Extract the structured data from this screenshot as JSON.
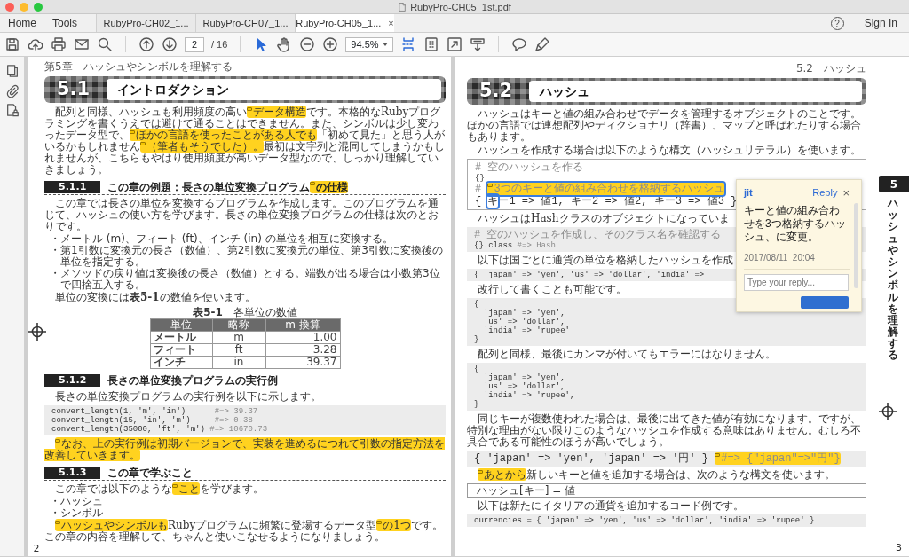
{
  "window": {
    "title": "RubyPro-CH05_1st.pdf"
  },
  "nav": {
    "home": "Home",
    "tools": "Tools",
    "help_glyph": "?",
    "sign_in": "Sign In"
  },
  "tabs": [
    {
      "label": "RubyPro-CH02_1...",
      "selected": false
    },
    {
      "label": "RubyPro-CH07_1...",
      "selected": false
    },
    {
      "label": "RubyPro-CH05_1...",
      "selected": true,
      "close_glyph": "×"
    }
  ],
  "toolbar": {
    "page_number": "2",
    "page_count": "/ 16",
    "zoom": "94.5%",
    "tool_modes": [
      {
        "selected": true
      },
      {
        "selected": false
      }
    ],
    "view_modes": [
      {
        "selected": true
      },
      {
        "selected": false
      },
      {
        "selected": false
      },
      {
        "selected": false
      }
    ]
  },
  "left_page": {
    "running_head": "第5章　ハッシュやシンボルを理解する",
    "page_number": "2",
    "blocks": [
      {
        "kind": "title",
        "number": "5.1",
        "text": "イントロダクション"
      },
      {
        "kind": "paragraph",
        "segments": [
          "配列と同様、ハッシュも利用頻度の高い",
          {
            "text": "データ構造",
            "highlight": true,
            "note": true
          },
          "です。本格的なRubyプログラミングを書くうえでは避けて通ることはできません。また、シンボルは少し変わったデータ型で、",
          {
            "text": "ほかの言語を使ったことがある人でも",
            "highlight": true,
            "note": true
          },
          "「初めて見た」と思う人がいるかもしれません",
          {
            "text": "（筆者もそうでした）。",
            "highlight": true,
            "note": true
          },
          "最初は文字列と混同してしまうかもしれませんが、こちらもやはり使用頻度が高いデータ型なので、しっかり理解していきましょう。"
        ]
      },
      {
        "kind": "subheading",
        "number": "5.1.1",
        "segments": [
          "この章の例題：長さの単位変換プログラム",
          {
            "text": "の仕様",
            "highlight": true,
            "note": true
          }
        ]
      },
      {
        "kind": "paragraph",
        "segments": [
          "この章では長さの単位を変換するプログラムを作成します。このプログラムを通じて、ハッシュの使い方を学びます。長さの単位変換プログラムの仕様は次のとおりです。"
        ]
      },
      {
        "kind": "bullet",
        "text": "・メートル (m)、フィート (ft)、インチ (in) の単位を相互に変換する。"
      },
      {
        "kind": "bullet",
        "text": "・第1引数に変換元の長さ（数値）、第2引数に変換元の単位、第3引数に変換後の単位を指定する。"
      },
      {
        "kind": "bullet",
        "text": "・メソッドの戻り値は変換後の長さ（数値）とする。端数が出る場合は小数第3位で四捨五入する。"
      },
      {
        "kind": "paragraph",
        "segments": [
          "単位の変換には**表5-1**の数値を使います。"
        ]
      },
      {
        "kind": "caption",
        "text": "**表5-1**　各単位の数値"
      },
      {
        "kind": "table",
        "columns": [
          "単位",
          "略称",
          "m 換算"
        ],
        "rows": [
          [
            "メートル",
            "m",
            "1.00"
          ],
          [
            "フィート",
            "ft",
            "3.28"
          ],
          [
            "インチ",
            "in",
            "39.37"
          ]
        ]
      },
      {
        "kind": "subheading",
        "number": "5.1.2",
        "segments": [
          "長さの単位変換プログラムの実行例"
        ]
      },
      {
        "kind": "paragraph",
        "segments": [
          "長さの単位変換プログラムの実行例を以下に示します。"
        ]
      },
      {
        "kind": "code",
        "lines": [
          [
            "convert_length(1, 'm', 'in')      ",
            {
              "text": "#=> 39.37",
              "kind": "comment"
            }
          ],
          [
            "convert_length(15, 'in', 'm')     ",
            {
              "text": "#=> 0.38",
              "kind": "comment"
            }
          ],
          [
            "convert_length(35000, 'ft', 'm') ",
            {
              "text": "#=> 10670.73",
              "kind": "comment"
            }
          ]
        ]
      },
      {
        "kind": "paragraph",
        "segments": [
          {
            "text": "なお、上の実行例は初期バージョンで、実装を進めるにつれて引数の指定方法を改善していきます。",
            "highlight": true,
            "note": true
          }
        ]
      },
      {
        "kind": "subheading",
        "number": "5.1.3",
        "segments": [
          "この章で学ぶこと"
        ]
      },
      {
        "kind": "paragraph",
        "segments": [
          "この章では以下のような",
          {
            "text": "こと",
            "highlight": true,
            "note": true
          },
          "を学びます。"
        ]
      },
      {
        "kind": "bullet",
        "text": "・ハッシュ"
      },
      {
        "kind": "bullet",
        "text": "・シンボル"
      },
      {
        "kind": "paragraph",
        "segments": [
          {
            "text": "ハッシュやシンボルも",
            "highlight": true,
            "note": true
          },
          "Rubyプログラムに頻繁に登場するデータ型",
          {
            "text": "の1つ",
            "highlight": true,
            "note": true
          },
          "です。この章の内容を理解して、ちゃんと使いこなせるようになりましょう。"
        ]
      }
    ]
  },
  "right_page": {
    "running_head": "5.2　ハッシュ",
    "page_number": "3",
    "chapter_tab": {
      "number": "5",
      "title": "ハッシュやシンボルを理解する"
    },
    "blocks": [
      {
        "kind": "title",
        "number": "5.2",
        "text": "ハッシュ"
      },
      {
        "kind": "paragraph",
        "segments": [
          "ハッシュはキーと値の組み合わせでデータを管理するオブジェクトのことです。ほかの言語では連想配列やディクショナリ（辞書）、マップと呼ばれたりする場合もあります。"
        ]
      },
      {
        "kind": "paragraph",
        "segments": [
          "ハッシュを作成する場合は以下のような構文（ハッシュリテラル）を使います。"
        ]
      },
      {
        "kind": "code_framed",
        "lines": [
          [
            {
              "text": "# 空のハッシュを作る",
              "kind": "comment"
            }
          ],
          [
            "{}"
          ],
          [
            {
              "text": "# ",
              "kind": "comment"
            },
            {
              "text": "3つのキーと値の組み合わせを格納するハッシュ",
              "kind": "comment",
              "highlight": true,
              "note": true,
              "focused": true
            }
          ],
          [
            "{ ",
            {
              "text": "キ",
              "focused": true
            },
            "ー1 => 値1, キー2 => 値2, キー3 => 値3 }"
          ]
        ],
        "comment": {
          "author": "jit",
          "reply": "Reply",
          "close": "×",
          "text": "キーと値の組み合わせを3つ格納するハッシュ、に変更。",
          "date": "2017/08/11  20:04",
          "placeholder": "Type your reply..."
        }
      },
      {
        "kind": "paragraph",
        "segments": [
          "ハッシュはHashクラスのオブジェクトになっていま"
        ]
      },
      {
        "kind": "code",
        "lines": [
          [
            {
              "text": "# 空のハッシュを作成し、そのクラス名を確認する",
              "kind": "comment"
            }
          ],
          [
            "{}.class ",
            {
              "text": "#=> Hash",
              "kind": "comment"
            }
          ]
        ]
      },
      {
        "kind": "paragraph",
        "segments": [
          "以下は国ごとに通貨の単位を格納したハッシュを作成"
        ]
      },
      {
        "kind": "code",
        "lines": [
          [
            "{ 'japan' => 'yen', 'us' => 'dollar', 'india' =>"
          ]
        ]
      },
      {
        "kind": "paragraph",
        "segments": [
          "改行して書くことも可能です。"
        ]
      },
      {
        "kind": "code",
        "lines": [
          [
            "{"
          ],
          [
            "  'japan' => 'yen',"
          ],
          [
            "  'us' => 'dollar',"
          ],
          [
            "  'india' => 'rupee'"
          ],
          [
            "}"
          ]
        ]
      },
      {
        "kind": "paragraph",
        "segments": [
          "配列と同様、最後にカンマが付いてもエラーにはなりません。"
        ]
      },
      {
        "kind": "code",
        "lines": [
          [
            "{"
          ],
          [
            "  'japan' => 'yen',"
          ],
          [
            "  'us' => 'dollar',"
          ],
          [
            "  'india' => 'rupee',"
          ],
          [
            "}"
          ]
        ]
      },
      {
        "kind": "paragraph",
        "segments": [
          "同じキーが複数使われた場合は、最後に出てきた値が有効になります。ですが、特別な理由がない限りこのようなハッシュを作成する意味はありません。むしろ不具合である可能性のほうが高いでしょう。"
        ]
      },
      {
        "kind": "code",
        "lines": [
          [
            "{ 'japan' => 'yen', 'japan' => '円' } ",
            {
              "text": "#=> {\"japan\"=>\"円\"}",
              "kind": "comment",
              "highlight": true,
              "note": true
            }
          ]
        ]
      },
      {
        "kind": "paragraph",
        "segments": [
          {
            "text": "あとから",
            "highlight": true,
            "note": true
          },
          "新しいキーと値を追加する場合は、次のような構文を使います。"
        ]
      },
      {
        "kind": "syntax_box",
        "text": "ハッシュ[キー] = 値"
      },
      {
        "kind": "paragraph",
        "segments": [
          "以下は新たにイタリアの通貨を追加するコード例です。"
        ]
      },
      {
        "kind": "code",
        "lines": [
          [
            "currencies = { 'japan' => 'yen', 'us' => 'dollar', 'india' => 'rupee' }"
          ]
        ]
      }
    ]
  }
}
